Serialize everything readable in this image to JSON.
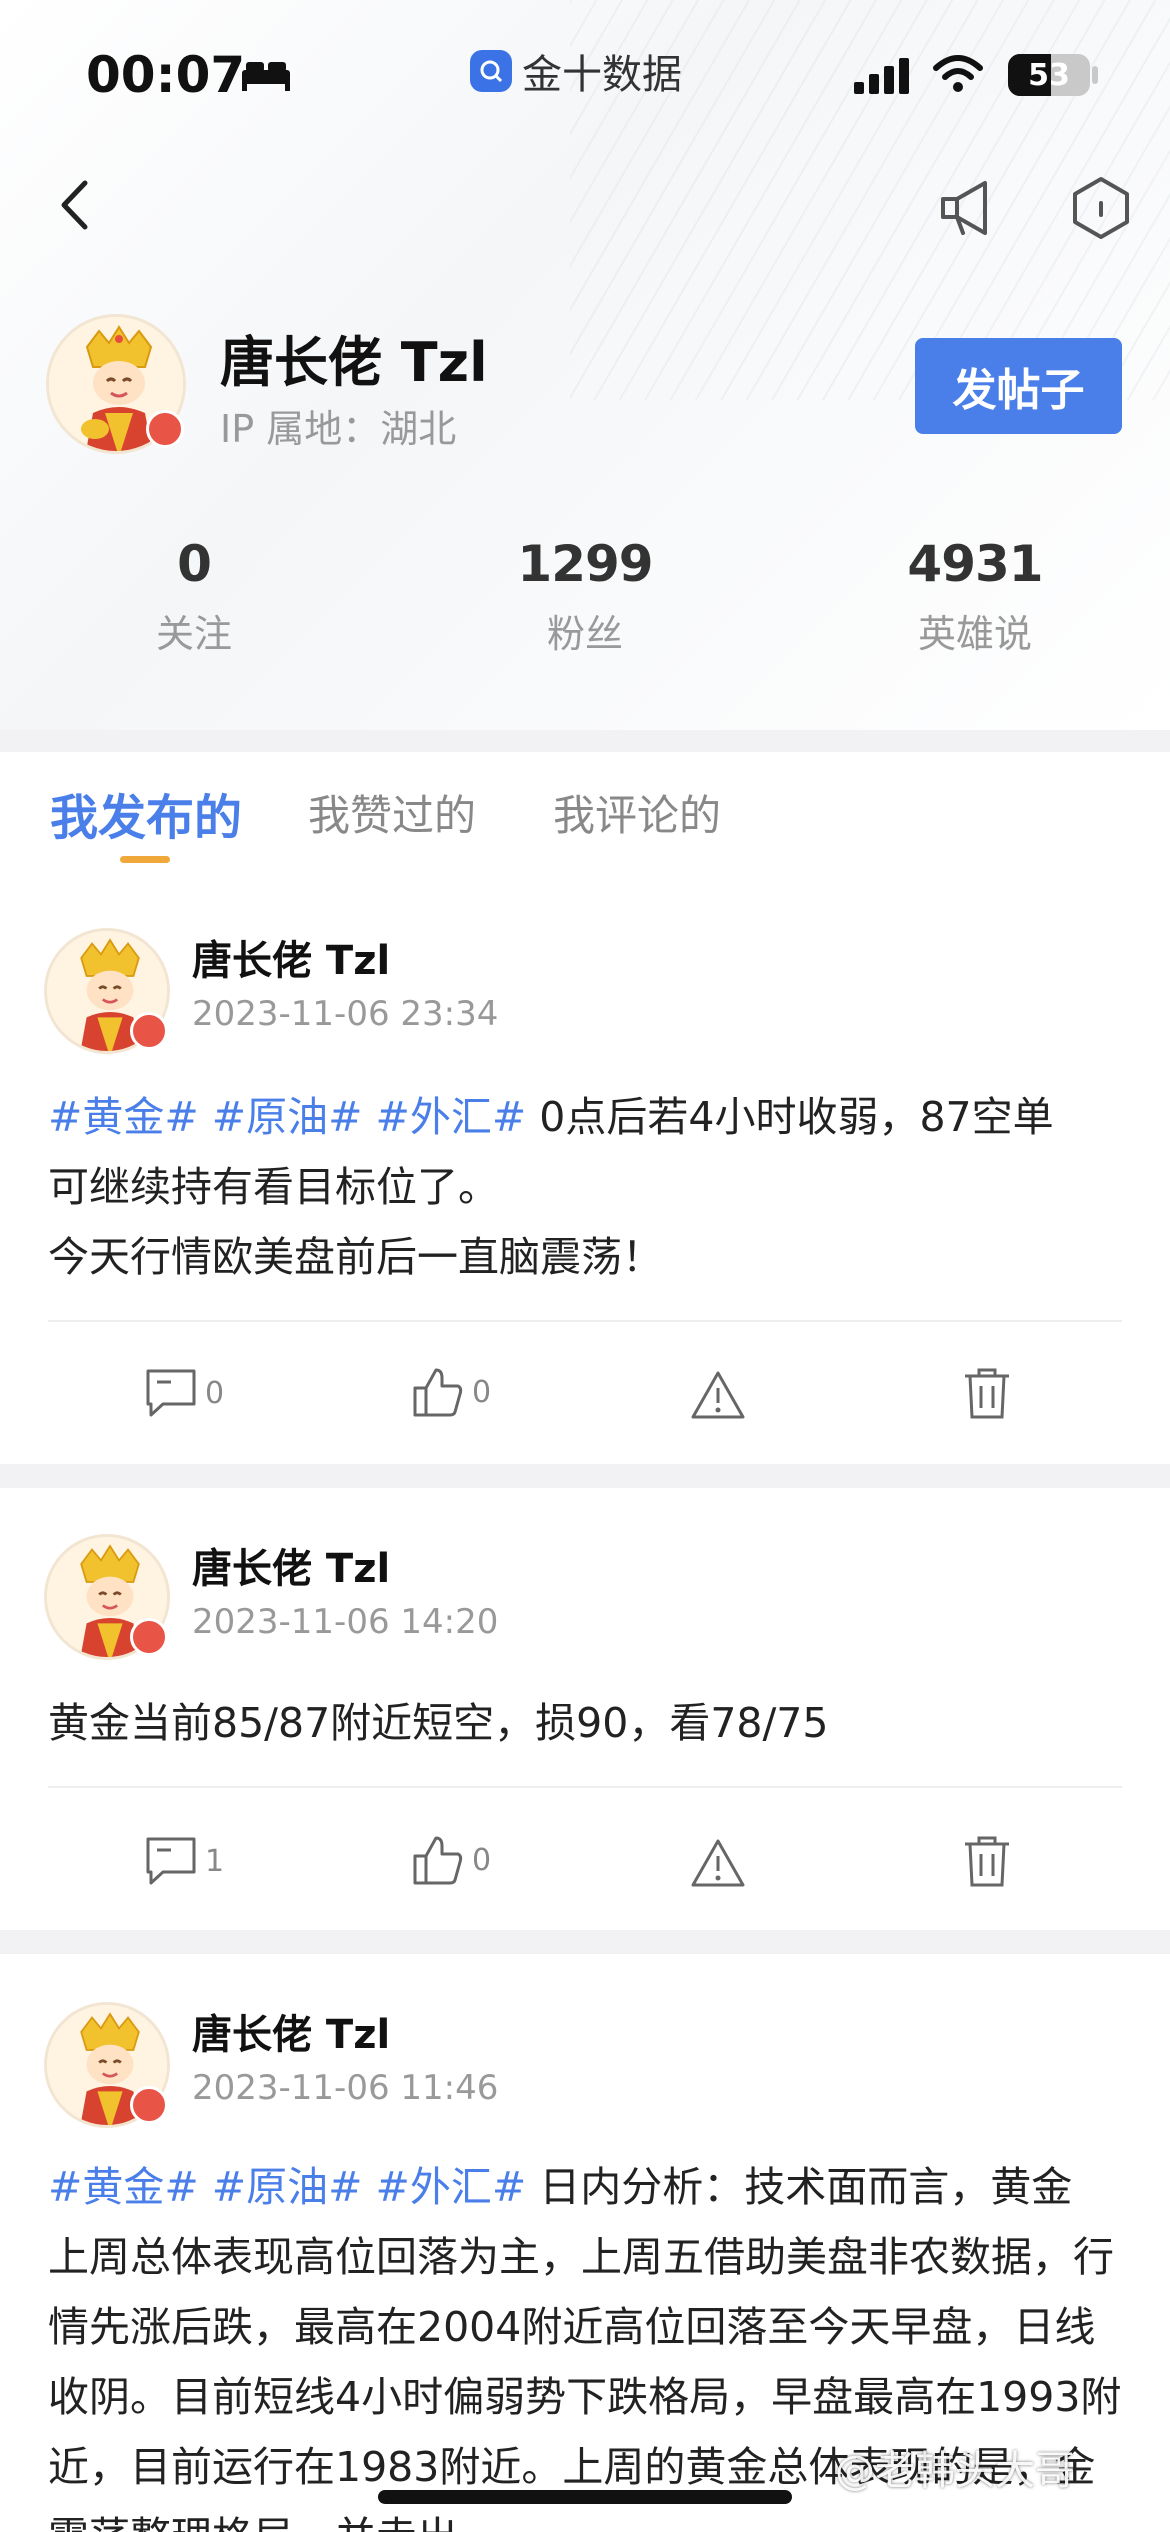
{
  "status_bar": {
    "time": "00:07",
    "app_name": "金十数据",
    "battery_percent": 53,
    "battery_label": "53"
  },
  "nav": {
    "back_icon": "chevron-left-icon",
    "announce_icon": "megaphone-icon",
    "settings_icon": "hexagon-icon"
  },
  "profile": {
    "name": "唐长佬 Tzl",
    "ip_location": "IP 属地：湖北",
    "post_button": "发帖子",
    "stats": [
      {
        "value": "0",
        "label": "关注"
      },
      {
        "value": "1299",
        "label": "粉丝"
      },
      {
        "value": "4931",
        "label": "英雄说"
      }
    ]
  },
  "tabs": [
    {
      "label": "我发布的",
      "active": true
    },
    {
      "label": "我赞过的",
      "active": false
    },
    {
      "label": "我评论的",
      "active": false
    }
  ],
  "posts": [
    {
      "author": "唐长佬 Tzl",
      "time": "2023-11-06 23:34",
      "tags": [
        "#黄金#",
        "#原油#",
        "#外汇#"
      ],
      "text_line1": " 0点后若4小时收弱，87空单",
      "text_rest": "可继续持有看目标位了。\n今天行情欧美盘前后一直脑震荡！",
      "comments": "0",
      "likes": "0"
    },
    {
      "author": "唐长佬 Tzl",
      "time": "2023-11-06 14:20",
      "text": "黄金当前85/87附近短空，损90，看78/75",
      "comments": "1",
      "likes": "0"
    },
    {
      "author": "唐长佬 Tzl",
      "time": "2023-11-06 11:46",
      "tags": [
        "#黄金#",
        "#原油#",
        "#外汇#"
      ],
      "text_line1": " 日内分析：技术面而言，黄金",
      "text_rest": "上周总体表现高位回落为主，上周五借助美盘非农数据，行情先涨后跌，最高在2004附近高位回落至今天早盘，日线收阴。目前短线4小时偏弱势下跌格局，早盘最高在1993附近，目前运行在1983附近。上周的黄金总体表现的是，金震荡整理格局，并走出"
    }
  ],
  "watermark": "@老韩头大哥"
}
